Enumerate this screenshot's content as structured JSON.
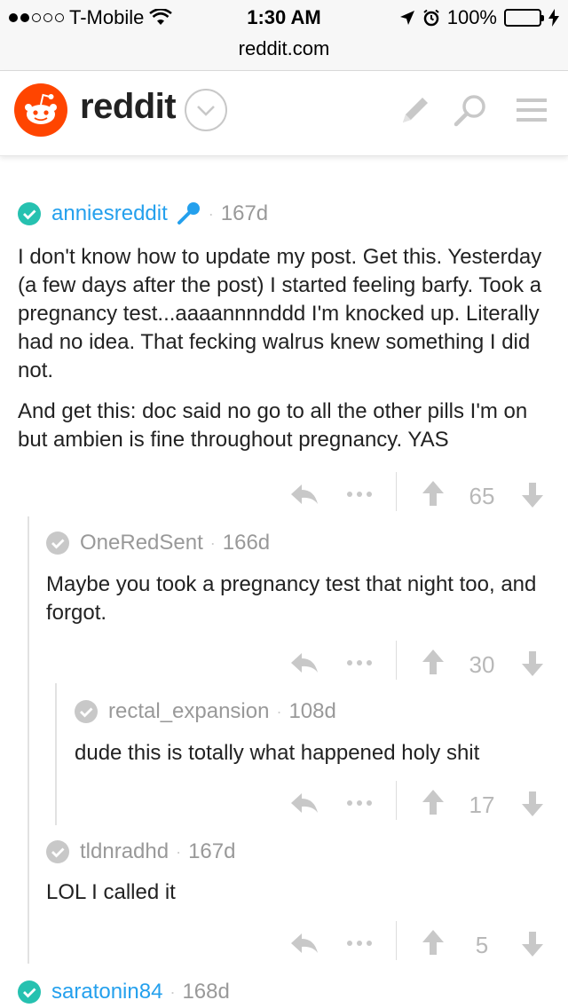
{
  "status_bar": {
    "carrier": "T-Mobile",
    "time": "1:30 AM",
    "battery": "100%",
    "url": "reddit.com"
  },
  "header": {
    "brand": "reddit",
    "icons": [
      "reddit-alien-logo",
      "dropdown-chevron-icon",
      "pencil-icon",
      "search-icon",
      "menu-icon"
    ]
  },
  "colors": {
    "reddit_orange": "#ff4500",
    "op_blue": "#24a0ed",
    "op_check_teal": "#26c1b0",
    "muted_gray": "#999999"
  },
  "comments": [
    {
      "author": "anniesreddit",
      "age": "167d",
      "is_op": true,
      "flair_icon": "microphone-icon",
      "paragraphs": [
        "I don't know how to update my post. Get this. Yesterday (a few days after the post) I started feeling barfy. Took a pregnancy test...aaaannnnddd I'm knocked up. Literally had no idea. That fecking walrus knew something I did not.",
        "And get this: doc said no go to all the other pills I'm on but ambien is fine throughout pregnancy. YAS"
      ],
      "score": "65"
    },
    {
      "author": "OneRedSent",
      "age": "166d",
      "is_op": false,
      "paragraphs": [
        "Maybe you took a pregnancy test that night too, and forgot."
      ],
      "score": "30"
    },
    {
      "author": "rectal_expansion",
      "age": "108d",
      "is_op": false,
      "paragraphs": [
        "dude this is totally what happened holy shit"
      ],
      "score": "17"
    },
    {
      "author": "tldnradhd",
      "age": "167d",
      "is_op": false,
      "paragraphs": [
        "LOL I called it"
      ],
      "score": "5"
    },
    {
      "author": "saratonin84",
      "age": "168d",
      "is_op": true,
      "paragraphs": [],
      "score": ""
    }
  ],
  "actions": [
    "reply-icon",
    "more-icon",
    "upvote-icon",
    "downvote-icon"
  ]
}
